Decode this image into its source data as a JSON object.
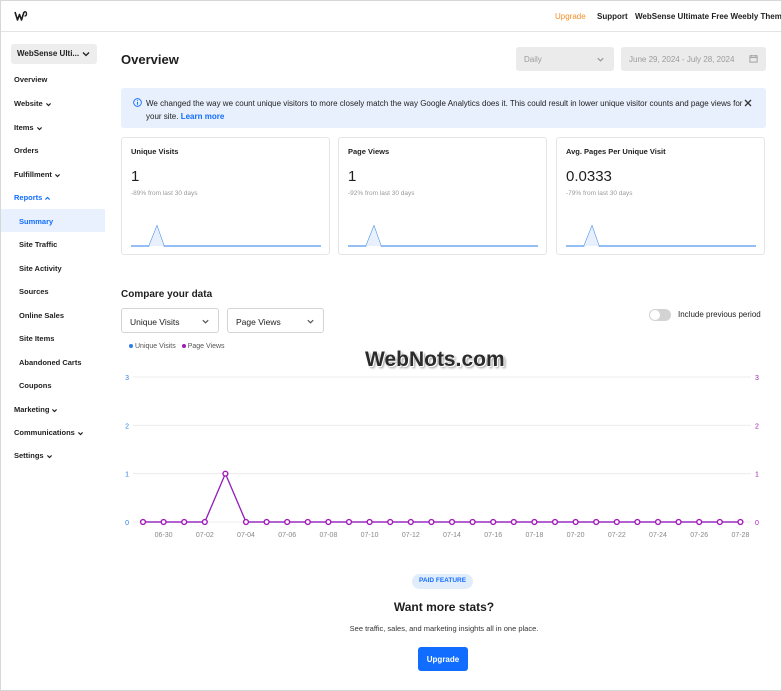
{
  "topbar": {
    "logo_icon": "weebly-w-icon",
    "upgrade": "Upgrade",
    "support": "Support",
    "site_name": "WebSense Ultimate Free Weebly Theme"
  },
  "sidebar": {
    "site_select": "WebSense Ulti...",
    "items": [
      {
        "label": "Overview"
      },
      {
        "label": "Website"
      },
      {
        "label": "Items"
      },
      {
        "label": "Orders"
      },
      {
        "label": "Fulfillment"
      },
      {
        "label": "Reports"
      },
      {
        "label": "Summary"
      },
      {
        "label": "Site Traffic"
      },
      {
        "label": "Site Activity"
      },
      {
        "label": "Sources"
      },
      {
        "label": "Online Sales"
      },
      {
        "label": "Site Items"
      },
      {
        "label": "Abandoned Carts"
      },
      {
        "label": "Coupons"
      },
      {
        "label": "Marketing"
      },
      {
        "label": "Communications"
      },
      {
        "label": "Settings"
      }
    ]
  },
  "main": {
    "title": "Overview",
    "period_select": "Daily",
    "date_range": "June 29, 2024 - July 28, 2024",
    "notice": {
      "text": "We changed the way we count unique visitors to more closely match the way Google Analytics does it. This could result in lower unique visitor counts and page views for your site.",
      "link": "Learn more"
    },
    "cards": [
      {
        "title": "Unique Visits",
        "value": "1",
        "sub": "-89% from last 30 days"
      },
      {
        "title": "Page Views",
        "value": "1",
        "sub": "-92% from last 30 days"
      },
      {
        "title": "Avg. Pages Per Unique Visit",
        "value": "0.0333",
        "sub": "-79% from last 30 days"
      }
    ],
    "compare": {
      "title": "Compare your data",
      "metric_a": "Unique Visits",
      "metric_b": "Page Views",
      "toggle_label": "Include previous period",
      "toggle_on": false
    },
    "watermark": "WebNots.com",
    "paid": {
      "badge": "PAID FEATURE",
      "heading": "Want more stats?",
      "desc": "See traffic, sales, and marketing insights all in one place.",
      "button": "Upgrade"
    },
    "colors": {
      "accent": "#116dff",
      "series_a": "#2b7de9",
      "series_b": "#a319b8",
      "upgrade_orange": "#f1902b"
    }
  },
  "chart_data": {
    "type": "line",
    "series": [
      {
        "name": "Unique Visits",
        "values": [
          0,
          0,
          0,
          0,
          1,
          0,
          0,
          0,
          0,
          0,
          0,
          0,
          0,
          0,
          0,
          0,
          0,
          0,
          0,
          0,
          0,
          0,
          0,
          0,
          0,
          0,
          0,
          0,
          0,
          0
        ]
      },
      {
        "name": "Page Views",
        "values": [
          0,
          0,
          0,
          0,
          1,
          0,
          0,
          0,
          0,
          0,
          0,
          0,
          0,
          0,
          0,
          0,
          0,
          0,
          0,
          0,
          0,
          0,
          0,
          0,
          0,
          0,
          0,
          0,
          0,
          0
        ]
      }
    ],
    "x_tick_labels": [
      "06-30",
      "07-02",
      "07-04",
      "07-06",
      "07-08",
      "07-10",
      "07-12",
      "07-14",
      "07-16",
      "07-18",
      "07-20",
      "07-22",
      "07-24",
      "07-26",
      "07-28"
    ],
    "ylim": [
      0,
      3
    ],
    "y_ticks": [
      "0",
      "1",
      "2",
      "3"
    ],
    "legend": "top-left",
    "grid": true
  }
}
